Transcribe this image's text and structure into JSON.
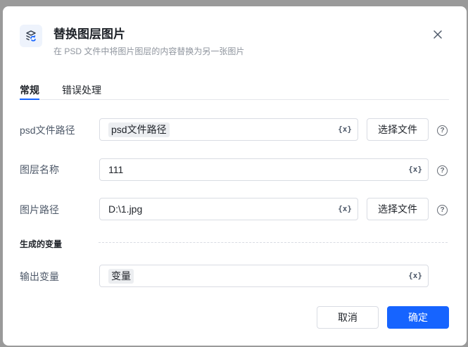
{
  "dialog": {
    "title": "替换图层图片",
    "subtitle": "在 PSD 文件中将图片图层的内容替换为另一张图片"
  },
  "tabs": [
    {
      "label": "常规",
      "active": true
    },
    {
      "label": "错误处理",
      "active": false
    }
  ],
  "fields": {
    "psd_path": {
      "label": "psd文件路径",
      "value": "psd文件路径",
      "browse_label": "选择文件"
    },
    "layer_name": {
      "label": "图层名称",
      "value": "111"
    },
    "image_path": {
      "label": "图片路径",
      "value": "D:\\1.jpg",
      "browse_label": "选择文件"
    }
  },
  "variable_button": "{x}",
  "help_symbol": "?",
  "generated_section": {
    "title": "生成的变量",
    "output_var": {
      "label": "输出变量",
      "value": "变量"
    }
  },
  "footer": {
    "cancel_label": "取消",
    "ok_label": "确定"
  },
  "colors": {
    "accent": "#1664ff",
    "chip_bg": "#eceef1",
    "border": "#d9dce3"
  },
  "icons": {
    "app": "layer-replace-icon",
    "close": "close-icon",
    "help": "help-circle-icon"
  }
}
